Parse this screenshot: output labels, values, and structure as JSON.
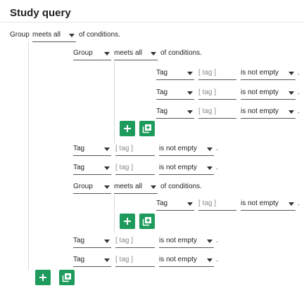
{
  "page": {
    "title": "Study query"
  },
  "group": {
    "label": "Group",
    "condition": "meets all",
    "suffix": "of conditions.",
    "nested_groups": [
      {
        "type": "Group",
        "condition": "meets all",
        "suffix": "of conditions.",
        "rows": [
          {
            "type": "Tag",
            "placeholder": "[ tag ]",
            "operator": "is not empty",
            "end": "."
          },
          {
            "type": "Tag",
            "placeholder": "[ tag ]",
            "operator": "is not empty",
            "end": "."
          },
          {
            "type": "Tag",
            "placeholder": "[ tag ]",
            "operator": "is not empty",
            "end": "."
          }
        ]
      },
      {
        "type": "Group",
        "condition": "meets all",
        "suffix": "of conditions.",
        "rows": [
          {
            "type": "Tag",
            "placeholder": "[ tag ]",
            "operator": "is not empty",
            "end": "."
          }
        ]
      }
    ],
    "rows_after_first_group": [
      {
        "type": "Tag",
        "placeholder": "[ tag ]",
        "operator": "is not empty",
        "end": "."
      },
      {
        "type": "Tag",
        "placeholder": "[ tag ]",
        "operator": "is not empty",
        "end": "."
      }
    ],
    "rows_after_second_group": [
      {
        "type": "Tag",
        "placeholder": "[ tag ]",
        "operator": "is not empty",
        "end": "."
      },
      {
        "type": "Tag",
        "placeholder": "[ tag ]",
        "operator": "is not empty",
        "end": "."
      }
    ]
  },
  "buttons": {
    "add_icon": "plus-icon",
    "add_group_icon": "add-group-icon",
    "color": "#1d9a5c"
  }
}
